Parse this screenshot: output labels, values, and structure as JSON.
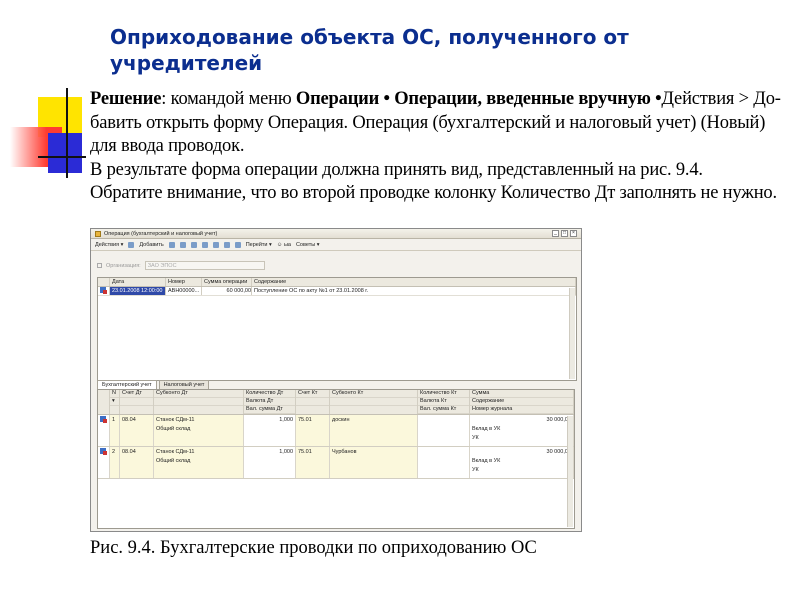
{
  "title": "Оприходование объекта ОС, полученного от учредителей",
  "solution": {
    "label": "Решение",
    "lead": ": командой меню ",
    "menu_path": "Операции • Операции, введенные вручную •",
    "line1_rest": "Действия > До-",
    "line2": "бавить открыть форму Операция. Операция (бухгалтерский и налоговый учет) (Новый)",
    "line3": "для ввода проводок.",
    "line4": "В результате форма операции должна принять вид, представленный на рис. 9.4.",
    "line5": "Обратите внимание, что во второй проводке колонку Количество Дт заполнять не нужно."
  },
  "window": {
    "title": "Операция (бухгалтерский и налоговый учет)",
    "toolbar": {
      "actions": "Действия ▾",
      "add": "Добавить",
      "goto": "Перейти ▾",
      "qa": "☺ ыa",
      "tips": "Советы ▾"
    },
    "organization": {
      "label": "Организация:",
      "value": "ЗАО ЭПОС"
    },
    "grid1": {
      "headers": [
        "Дата",
        "Номер",
        "Сумма операции",
        "Содержание"
      ],
      "row": {
        "date": "23.01.2008 12:00:00",
        "number": "АВН00000...",
        "sum": "60 000,00",
        "content": "Поступление ОС по акту №1 от 23.01.2008 г."
      }
    },
    "tabs": [
      "Бухгалтерский учет",
      "Налоговый учет"
    ],
    "grid2": {
      "headers": {
        "num": "N",
        "debit_account": "Счет Дт",
        "subconto_dt": "Субконто Дт",
        "qty_dt": "Количество Дт",
        "curr_dt": "Валюта Дт",
        "curr_sum_dt": "Вал. сумма Дт",
        "credit_account": "Счет Кт",
        "subconto_kt": "Субконто Кт",
        "qty_kt": "Количество Кт",
        "curr_kt": "Валюта Кт",
        "curr_sum_kt": "Вал. сумма Кт",
        "sum": "Сумма",
        "content": "Содержание",
        "journal": "Номер журнала"
      },
      "rows": [
        {
          "n": "1",
          "dt": "08.04",
          "sub1": "Станок СДм-11",
          "sub2": "Общий склад",
          "qty": "1,000",
          "kt": "75.01",
          "subkt": "доскин",
          "sum": "30 000,00",
          "content": "Вклад в УК",
          "journal": "УК"
        },
        {
          "n": "2",
          "dt": "08.04",
          "sub1": "Станок СДм-11",
          "sub2": "Общий склад",
          "qty": "1,000",
          "kt": "75.01",
          "subkt": "Чурбанов",
          "sum": "30 000,00",
          "content": "Вклад в УК",
          "journal": "УК"
        }
      ]
    }
  },
  "caption": "Рис. 9.4. Бухгалтерские проводки по оприходованию ОС"
}
